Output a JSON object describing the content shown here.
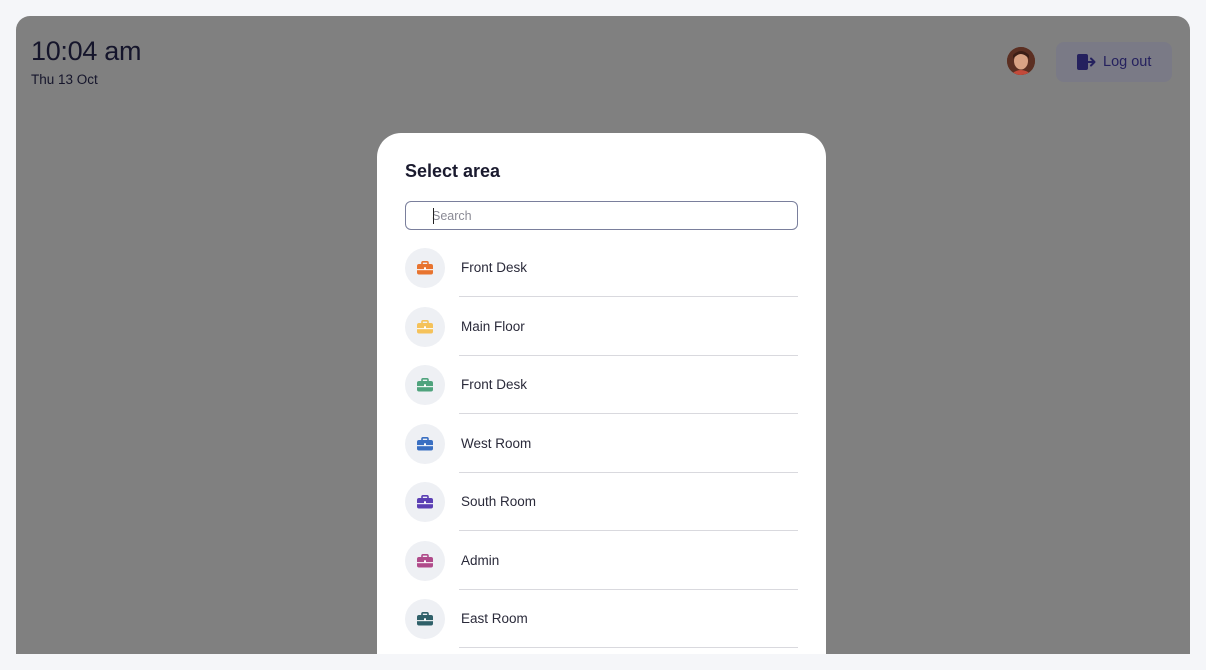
{
  "header": {
    "time": "10:04 am",
    "date": "Thu 13 Oct",
    "logout_label": "Log out"
  },
  "modal": {
    "title": "Select area",
    "search_placeholder": "Search",
    "search_value": ""
  },
  "areas": [
    {
      "label": "Front Desk",
      "color": "#e8742f",
      "icon": "briefcase-icon"
    },
    {
      "label": "Main Floor",
      "color": "#f5c25a",
      "icon": "briefcase-icon"
    },
    {
      "label": "Front Desk",
      "color": "#4fa37d",
      "icon": "briefcase-icon"
    },
    {
      "label": "West Room",
      "color": "#3a6fc2",
      "icon": "briefcase-icon"
    },
    {
      "label": "South Room",
      "color": "#5b3fb4",
      "icon": "briefcase-icon"
    },
    {
      "label": "Admin",
      "color": "#b04b8a",
      "icon": "briefcase-icon"
    },
    {
      "label": "East Room",
      "color": "#2f6069",
      "icon": "briefcase-icon"
    }
  ]
}
